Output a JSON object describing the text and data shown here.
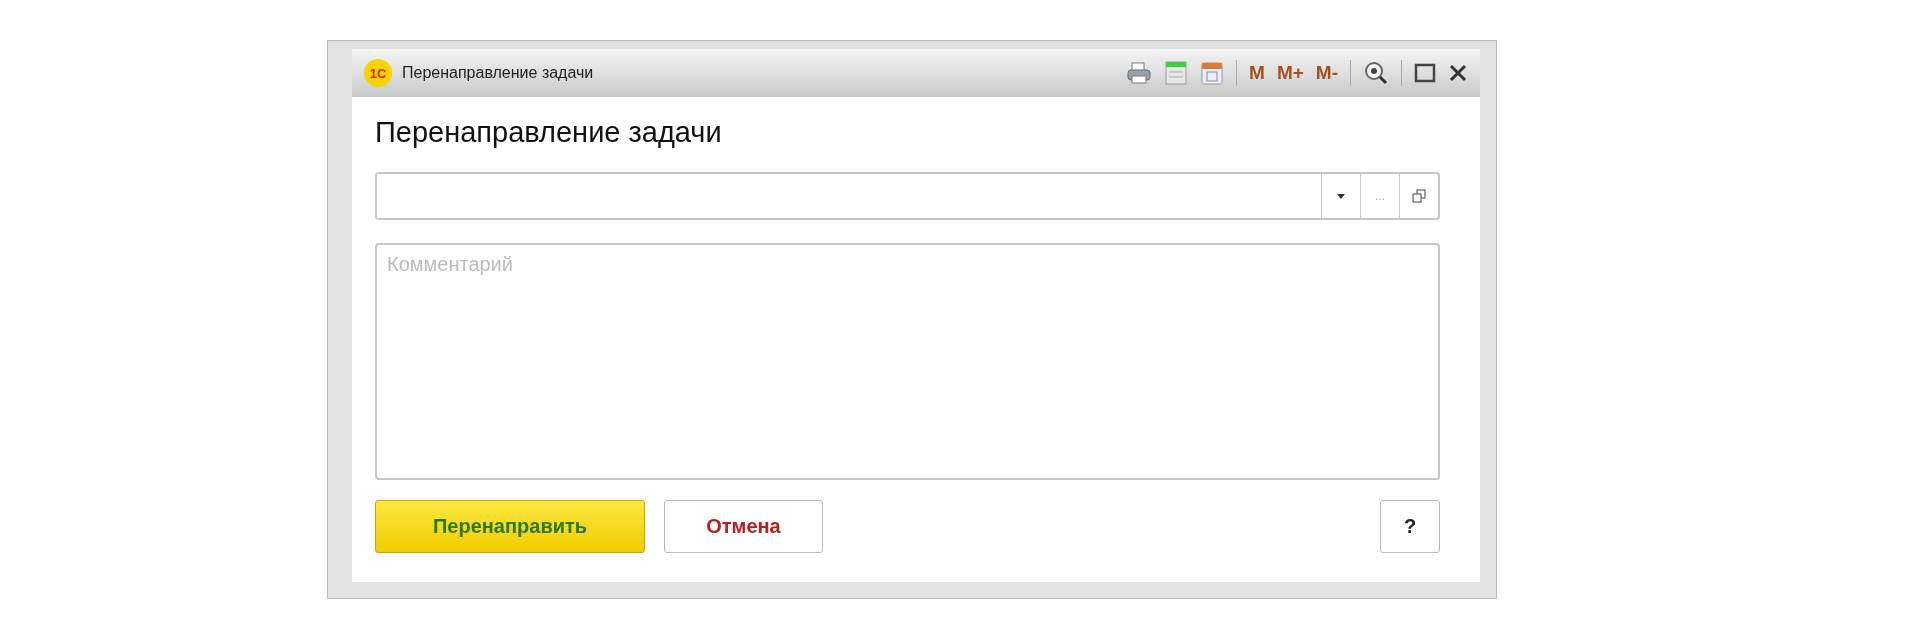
{
  "window": {
    "logo": "1С",
    "title": "Перенаправление задачи",
    "toolbar": [
      {
        "kind": "print"
      },
      {
        "kind": "table"
      },
      {
        "kind": "calendar"
      },
      {
        "kind": "memory",
        "label": "M"
      },
      {
        "kind": "memory",
        "label": "M+"
      },
      {
        "kind": "memory",
        "label": "M-"
      },
      {
        "kind": "zoom"
      },
      {
        "kind": "maximize"
      },
      {
        "kind": "close"
      }
    ]
  },
  "heading": "Перенаправление задачи",
  "assignee_field": {
    "ellipsis": "..."
  },
  "comment": {
    "placeholder": "Комментарий"
  },
  "buttons": [
    {
      "label": "Перенаправить",
      "kind": "primary"
    },
    {
      "label": "Отмена",
      "kind": "cancel"
    },
    {
      "label": "?",
      "kind": "help"
    }
  ]
}
